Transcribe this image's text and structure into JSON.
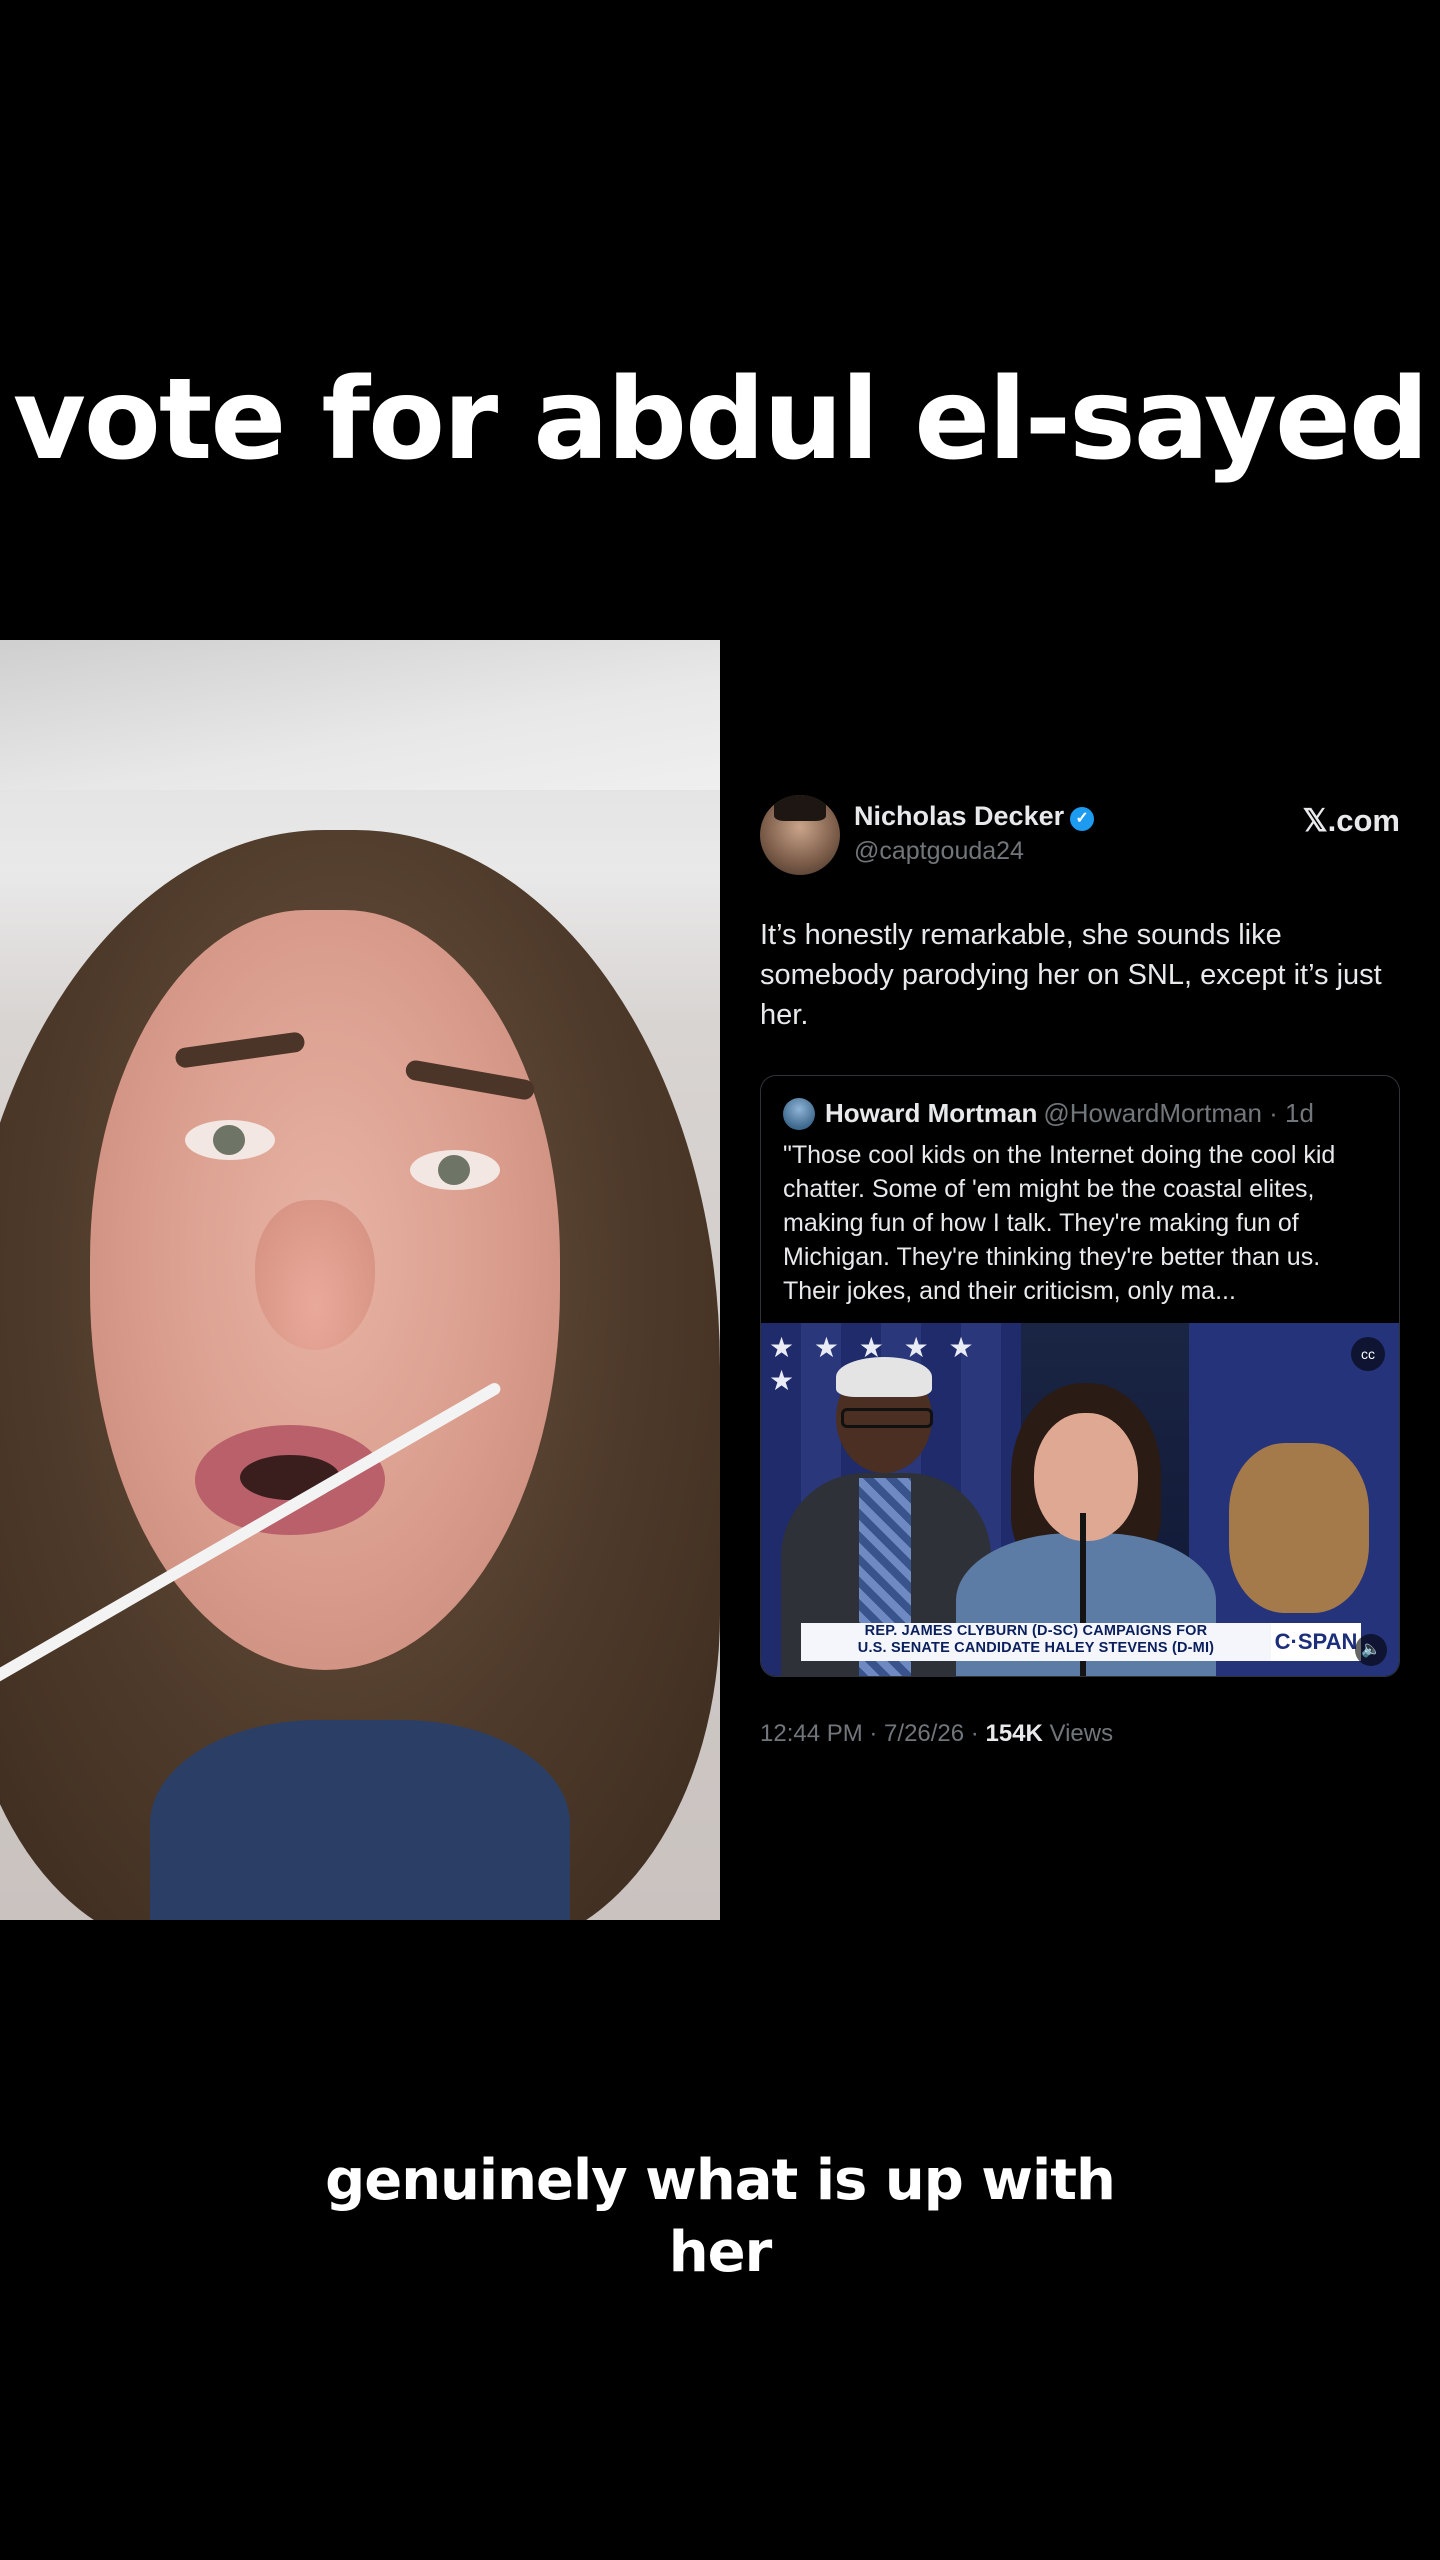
{
  "headline": "vote for abdul el-sayed",
  "tweet": {
    "author_name": "Nicholas Decker",
    "author_handle": "@captgouda24",
    "verified_icon": "verified-badge-icon",
    "site": "𝕏.com",
    "text": "It’s honestly remarkable, she sounds like somebody parodying her on SNL, except it’s just her.",
    "quoted": {
      "author_name": "Howard Mortman",
      "author_handle": "@HowardMortman · 1d",
      "text": "\"Those cool kids on the Internet doing the cool kid chatter. Some of 'em might be the coastal elites, making fun of how I talk. They're making fun of Michigan. They're thinking they're better than us. Their jokes, and their criticism, only ma...",
      "media": {
        "lower_third_line1": "REP. JAMES CLYBURN (D-SC) CAMPAIGNS FOR",
        "lower_third_line2": "U.S. SENATE CANDIDATE HALEY STEVENS (D-MI)",
        "network": "C·SPAN",
        "captions_icon": "cc",
        "volume_icon": "🔈"
      }
    },
    "meta_time": "12:44 PM · 7/26/26 · ",
    "meta_views_count": "154K",
    "meta_views_label": "Views"
  },
  "caption": {
    "line1": "genuinely what is up with",
    "line2": "her"
  }
}
